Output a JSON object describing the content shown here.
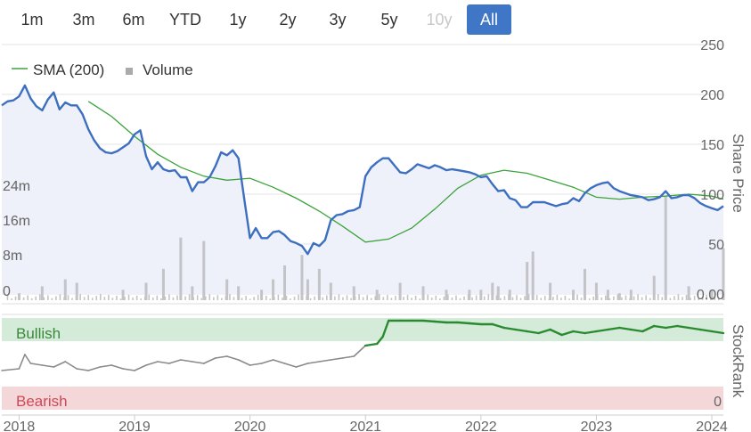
{
  "range_selector": {
    "buttons": [
      "1m",
      "3m",
      "6m",
      "YTD",
      "1y",
      "2y",
      "3y",
      "5y",
      "10y",
      "All"
    ],
    "disabled": "10y",
    "active": "All"
  },
  "legend": {
    "sma_label": "SMA (200)",
    "volume_label": "Volume"
  },
  "axes": {
    "price_axis_label": "Share Price",
    "stockrank_axis_label": "StockRank",
    "price_ticks": [
      "250",
      "200",
      "150",
      "100",
      "50",
      "0.00"
    ],
    "volume_ticks": [
      "24m",
      "16m",
      "8m",
      "0"
    ],
    "stockrank_zero": "0",
    "x_ticks": [
      "2018",
      "2019",
      "2020",
      "2021",
      "2022",
      "2023",
      "2024"
    ]
  },
  "bands": {
    "bullish": "Bullish",
    "bearish": "Bearish"
  },
  "colors": {
    "price_line": "#3d6fc1",
    "price_fill": "#eef1f9",
    "sma_line": "#3ba33a",
    "volume_bar": "#c4c4c8",
    "bullish_band": "#d3ebd8",
    "bullish_text": "#3b8a3a",
    "bearish_band": "#f4d7d9",
    "bearish_text": "#d04858",
    "rank_grey": "#8a8a8a",
    "rank_green": "#2a8a2f",
    "active_button": "#3f76c6"
  },
  "chart_data": {
    "type": "line",
    "price_ylim": [
      0,
      250
    ],
    "volume_ylim": [
      0,
      32
    ],
    "stockrank_ylim": [
      0,
      100
    ],
    "price_series": {
      "name": "Share Price",
      "x": [
        2017.85,
        2017.9,
        2017.95,
        2018.0,
        2018.05,
        2018.1,
        2018.15,
        2018.2,
        2018.25,
        2018.3,
        2018.35,
        2018.4,
        2018.45,
        2018.5,
        2018.55,
        2018.6,
        2018.65,
        2018.7,
        2018.75,
        2018.8,
        2018.85,
        2018.9,
        2018.95,
        2019.0,
        2019.05,
        2019.1,
        2019.15,
        2019.2,
        2019.25,
        2019.3,
        2019.35,
        2019.4,
        2019.45,
        2019.5,
        2019.55,
        2019.6,
        2019.65,
        2019.7,
        2019.75,
        2019.8,
        2019.85,
        2019.9,
        2019.95,
        2020.0,
        2020.05,
        2020.1,
        2020.15,
        2020.2,
        2020.25,
        2020.3,
        2020.35,
        2020.4,
        2020.45,
        2020.5,
        2020.55,
        2020.6,
        2020.65,
        2020.7,
        2020.75,
        2020.8,
        2020.85,
        2020.9,
        2020.95,
        2021.0,
        2021.05,
        2021.1,
        2021.15,
        2021.2,
        2021.25,
        2021.3,
        2021.35,
        2021.4,
        2021.45,
        2021.5,
        2021.55,
        2021.6,
        2021.65,
        2021.7,
        2021.75,
        2021.8,
        2021.85,
        2021.9,
        2021.95,
        2022.0,
        2022.05,
        2022.1,
        2022.15,
        2022.2,
        2022.25,
        2022.3,
        2022.35,
        2022.4,
        2022.45,
        2022.5,
        2022.55,
        2022.6,
        2022.65,
        2022.7,
        2022.75,
        2022.8,
        2022.85,
        2022.9,
        2022.95,
        2023.0,
        2023.05,
        2023.1,
        2023.15,
        2023.2,
        2023.25,
        2023.3,
        2023.35,
        2023.4,
        2023.45,
        2023.5,
        2023.55,
        2023.6,
        2023.65,
        2023.7,
        2023.75,
        2023.8,
        2023.85,
        2023.9,
        2023.95,
        2024.0,
        2024.05,
        2024.1
      ],
      "values": [
        189,
        193,
        194,
        198,
        209,
        196,
        188,
        184,
        195,
        202,
        185,
        192,
        189,
        189,
        180,
        165,
        154,
        146,
        142,
        141,
        143,
        147,
        151,
        160,
        164,
        138,
        125,
        132,
        125,
        123,
        124,
        117,
        117,
        103,
        112,
        112,
        117,
        128,
        142,
        139,
        144,
        136,
        95,
        56,
        66,
        56,
        56,
        62,
        63,
        59,
        53,
        51,
        48,
        40,
        51,
        48,
        54,
        74,
        79,
        80,
        83,
        84,
        87,
        118,
        127,
        132,
        136,
        136,
        129,
        122,
        121,
        125,
        130,
        128,
        126,
        129,
        127,
        124,
        125,
        124,
        123,
        122,
        120,
        117,
        118,
        110,
        103,
        104,
        96,
        94,
        87,
        87,
        92,
        92,
        92,
        90,
        88,
        90,
        91,
        96,
        93,
        101,
        106,
        109,
        111,
        112,
        106,
        103,
        101,
        99,
        98,
        97,
        94,
        95,
        97,
        103,
        96,
        97,
        99,
        99,
        96,
        91,
        88,
        86,
        84,
        88,
        92,
        93
      ]
    },
    "sma_series": {
      "name": "SMA (200)",
      "x": [
        2018.6,
        2018.8,
        2019.0,
        2019.2,
        2019.4,
        2019.6,
        2019.8,
        2020.0,
        2020.2,
        2020.4,
        2020.6,
        2020.8,
        2021.0,
        2021.2,
        2021.4,
        2021.6,
        2021.8,
        2022.0,
        2022.2,
        2022.4,
        2022.6,
        2022.8,
        2023.0,
        2023.2,
        2023.4,
        2023.6,
        2023.8,
        2024.0,
        2024.1
      ],
      "values": [
        193,
        178,
        158,
        140,
        127,
        118,
        114,
        116,
        107,
        96,
        83,
        68,
        52,
        55,
        66,
        85,
        106,
        119,
        124,
        121,
        114,
        107,
        97,
        95,
        97,
        98,
        100,
        98,
        95
      ]
    },
    "volume_series": {
      "name": "Volume",
      "x": [
        2018.0,
        2018.2,
        2018.4,
        2018.5,
        2018.9,
        2019.1,
        2019.25,
        2019.4,
        2019.5,
        2019.6,
        2019.8,
        2019.9,
        2020.1,
        2020.2,
        2020.3,
        2020.45,
        2020.5,
        2020.6,
        2020.7,
        2020.9,
        2021.1,
        2021.3,
        2021.5,
        2021.7,
        2021.9,
        2022.0,
        2022.1,
        2022.15,
        2022.25,
        2022.4,
        2022.45,
        2022.6,
        2022.8,
        2022.9,
        2023.0,
        2023.1,
        2023.2,
        2023.3,
        2023.5,
        2023.6,
        2023.8,
        2024.0,
        2024.1
      ],
      "values": [
        2,
        4,
        6,
        5,
        3,
        5,
        9,
        18,
        4,
        17,
        6,
        4,
        3,
        6,
        10,
        13,
        6,
        9,
        5,
        4,
        3,
        5,
        4,
        3,
        3,
        3,
        5,
        4,
        3,
        11,
        14,
        5,
        3,
        9,
        5,
        3,
        2,
        3,
        7,
        30,
        4,
        3,
        15
      ]
    },
    "stockrank_series": {
      "name": "StockRank",
      "x": [
        2017.85,
        2018.0,
        2018.05,
        2018.1,
        2018.2,
        2018.3,
        2018.4,
        2018.5,
        2018.6,
        2018.7,
        2018.8,
        2018.9,
        2019.0,
        2019.1,
        2019.2,
        2019.3,
        2019.4,
        2019.5,
        2019.6,
        2019.7,
        2019.8,
        2019.9,
        2020.0,
        2020.1,
        2020.2,
        2020.3,
        2020.4,
        2020.5,
        2020.6,
        2020.7,
        2020.8,
        2020.9,
        2021.0,
        2021.1,
        2021.15,
        2021.2,
        2021.3,
        2021.4,
        2021.5,
        2021.6,
        2021.7,
        2021.8,
        2021.9,
        2022.0,
        2022.1,
        2022.2,
        2022.3,
        2022.4,
        2022.5,
        2022.6,
        2022.7,
        2022.8,
        2022.9,
        2023.0,
        2023.1,
        2023.2,
        2023.3,
        2023.4,
        2023.5,
        2023.6,
        2023.7,
        2023.8,
        2023.9,
        2024.0,
        2024.1
      ],
      "values": [
        42,
        44,
        60,
        50,
        48,
        46,
        52,
        44,
        42,
        46,
        48,
        44,
        42,
        48,
        52,
        50,
        54,
        52,
        50,
        56,
        58,
        54,
        48,
        50,
        54,
        50,
        46,
        50,
        52,
        54,
        56,
        58,
        70,
        72,
        80,
        98,
        98,
        98,
        98,
        97,
        96,
        96,
        95,
        94,
        94,
        90,
        88,
        86,
        84,
        88,
        82,
        86,
        84,
        86,
        88,
        90,
        88,
        86,
        92,
        90,
        92,
        90,
        88,
        86,
        84
      ]
    },
    "stockrank_bullish_threshold": 70
  }
}
